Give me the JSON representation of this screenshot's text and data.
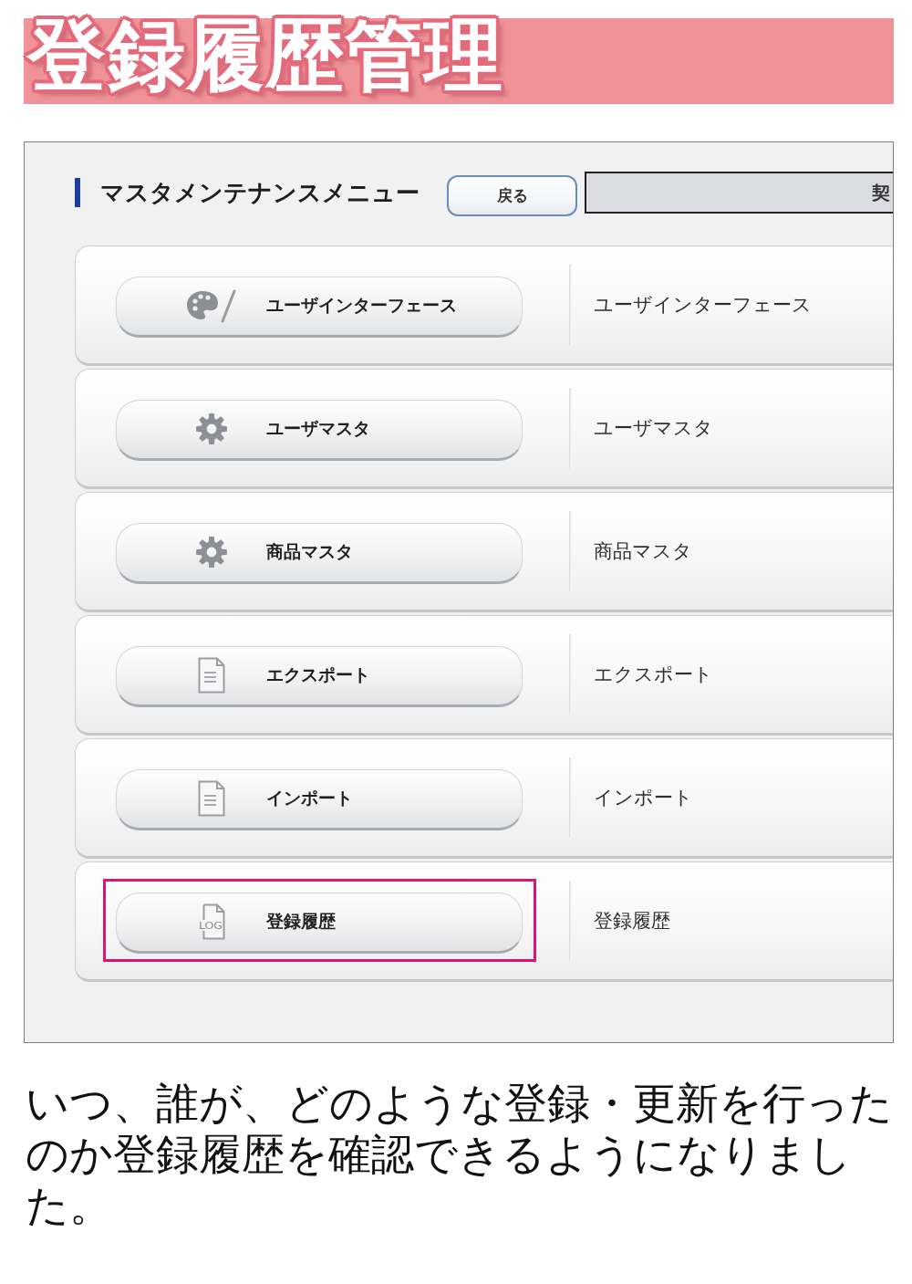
{
  "title": "登録履歴管理",
  "screen": {
    "heading": "マスタメンテナンスメニュー",
    "back_button": "戻る",
    "info_field": "契",
    "menu": [
      {
        "kind": "palette",
        "label": "ユーザインターフェース",
        "description": "ユーザインターフェース",
        "highlighted": false
      },
      {
        "kind": "gear",
        "label": "ユーザマスタ",
        "description": "ユーザマスタ",
        "highlighted": false
      },
      {
        "kind": "gear",
        "label": "商品マスタ",
        "description": "商品マスタ",
        "highlighted": false
      },
      {
        "kind": "document",
        "label": "エクスポート",
        "description": "エクスポート",
        "highlighted": false
      },
      {
        "kind": "document",
        "label": "インポート",
        "description": "インポート",
        "highlighted": false
      },
      {
        "kind": "log",
        "icon_label": "LOG",
        "label": "登録履歴",
        "description": "登録履歴",
        "highlighted": true
      }
    ]
  },
  "caption": "いつ、誰が、どのような登録・更新を行ったのか登録履歴を確認できるようになりました。"
}
